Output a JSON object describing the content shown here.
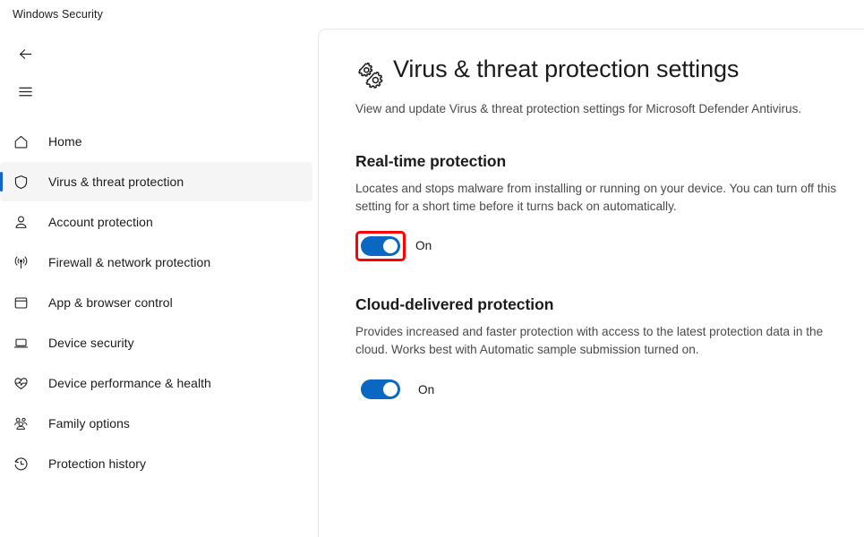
{
  "window": {
    "title": "Windows Security"
  },
  "sidebar": {
    "back_button": "back-arrow",
    "menu_button": "hamburger-menu",
    "items": [
      {
        "label": "Home",
        "icon": "home-icon",
        "selected": false
      },
      {
        "label": "Virus & threat protection",
        "icon": "shield-icon",
        "selected": true
      },
      {
        "label": "Account protection",
        "icon": "person-icon",
        "selected": false
      },
      {
        "label": "Firewall & network protection",
        "icon": "wireless-icon",
        "selected": false
      },
      {
        "label": "App & browser control",
        "icon": "window-icon",
        "selected": false
      },
      {
        "label": "Device security",
        "icon": "laptop-icon",
        "selected": false
      },
      {
        "label": "Device performance & health",
        "icon": "heart-pulse-icon",
        "selected": false
      },
      {
        "label": "Family options",
        "icon": "people-icon",
        "selected": false
      },
      {
        "label": "Protection history",
        "icon": "history-clock-icon",
        "selected": false
      }
    ]
  },
  "main": {
    "page_title": "Virus & threat protection settings",
    "page_title_icon": "gears-icon",
    "page_subtitle": "View and update Virus & threat protection settings for Microsoft Defender Antivirus.",
    "sections": [
      {
        "title": "Real-time protection",
        "description": "Locates and stops malware from installing or running on your device. You can turn off this setting for a short time before it turns back on automatically.",
        "toggle_state": "On",
        "toggle_on": true,
        "highlighted": true
      },
      {
        "title": "Cloud-delivered protection",
        "description": "Provides increased and faster protection with access to the latest protection data in the cloud. Works best with Automatic sample submission turned on.",
        "toggle_state": "On",
        "toggle_on": true,
        "highlighted": false
      }
    ]
  },
  "colors": {
    "accent": "#0a67c2",
    "selection_bar": "#0f65c8",
    "highlight_box": "#ff0000",
    "selected_row_bg": "#f5f5f5"
  }
}
